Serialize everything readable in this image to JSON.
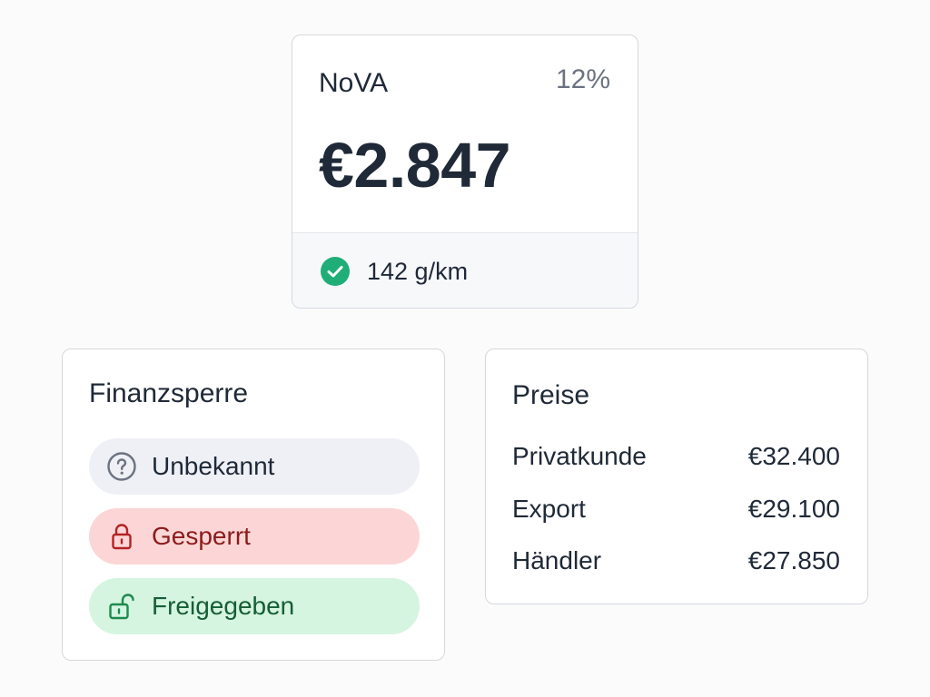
{
  "nova": {
    "title": "NoVA",
    "rate": "12%",
    "amount": "€2.847",
    "emission": "142 g/km",
    "status_icon": "check-circle-icon",
    "status_color": "#1fae78"
  },
  "finanzsperre": {
    "title": "Finanzsperre",
    "options": [
      {
        "label": "Unbekannt",
        "icon": "question-circle-icon",
        "bg": "#eef0f6",
        "color": "#1f2937"
      },
      {
        "label": "Gesperrt",
        "icon": "lock-icon",
        "bg": "#fcd6d6",
        "color": "#8b1c1c"
      },
      {
        "label": "Freigegeben",
        "icon": "unlock-icon",
        "bg": "#d5f5e0",
        "color": "#155e36"
      }
    ]
  },
  "preise": {
    "title": "Preise",
    "rows": [
      {
        "label": "Privatkunde",
        "value": "€32.400"
      },
      {
        "label": "Export",
        "value": "€29.100"
      },
      {
        "label": "Händler",
        "value": "€27.850"
      }
    ]
  }
}
